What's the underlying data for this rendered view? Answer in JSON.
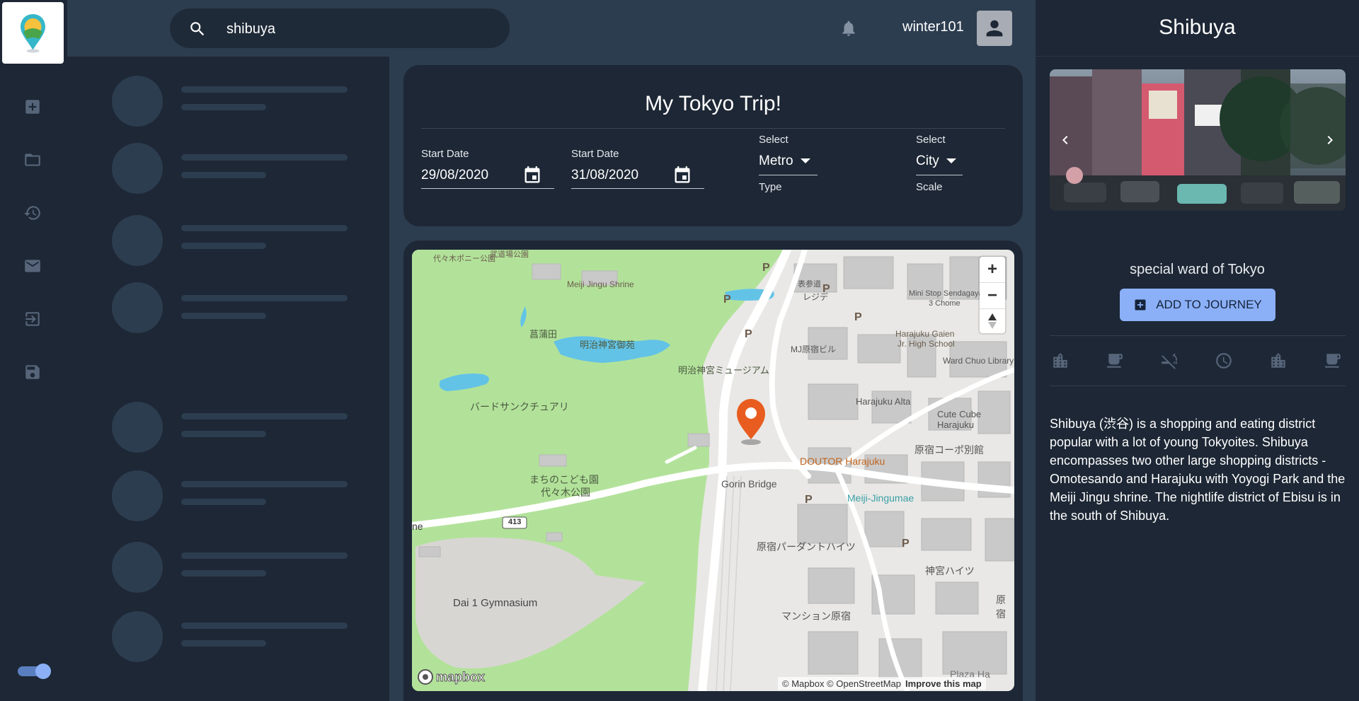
{
  "search": {
    "value": "shibuya",
    "placeholder": "Search"
  },
  "user": {
    "name": "winter101"
  },
  "nav": {
    "items": [
      {
        "icon": "add-box-icon"
      },
      {
        "icon": "folder-icon"
      },
      {
        "icon": "history-icon"
      },
      {
        "icon": "mail-icon"
      },
      {
        "icon": "logout-icon"
      },
      {
        "icon": "save-icon"
      }
    ]
  },
  "trip": {
    "title": "My Tokyo Trip!",
    "start_date": {
      "label": "Start Date",
      "value": "29/08/2020"
    },
    "end_date": {
      "label": "Start Date",
      "value": "31/08/2020"
    },
    "type_select": {
      "label": "Select",
      "value": "Metro",
      "helper": "Type"
    },
    "scale_select": {
      "label": "Select",
      "value": "City",
      "helper": "Scale"
    }
  },
  "map": {
    "labels": {
      "meiji_shrine": "Meiji Jingu Shrine",
      "bird_sanctuary": "バードサンクチュアリ",
      "shobuda": "菖蒲田",
      "meiji_jingu_gyoen": "明治神宮御苑",
      "museum": "明治神宮ミュージアム",
      "childrens_park": "まちのこども園",
      "yoyogi_park": "代々木公園",
      "gorin_bridge": "Gorin Bridge",
      "doutor": "DOUTOR Harajuku",
      "meiji_jingumae": "Meiji-Jingumae",
      "harajuku_alta": "Harajuku Alta",
      "cute_cube": "Cute Cube Harajuku",
      "harajuku_gaien": "Harajuku Gaien",
      "jr_high": "Jr. High School",
      "mini_stop": "Mini Stop Sendagaya",
      "third_chome": "3 Chome",
      "ward_library": "Ward Chuo Library",
      "parthenon_heights": "原宿パーダントハイツ",
      "jingu_heights": "神宮ハイツ",
      "mansion": "マンション原宿",
      "dai1_gym": "Dai 1 Gymnasium",
      "route": "413",
      "edge_label": "ne",
      "plaza": "Plaza Ha",
      "harajuku_corp": "原宿コーポ別館",
      "reji": "レジデ",
      "meiji_building": "MJ原宿ビル",
      "top_left": "代々木ポニー公園",
      "top_left2": "武道場公園",
      "top_right": "表参道",
      "edge_right": "原宿",
      "attribution": "© Mapbox © OpenStreetMap",
      "improve": "Improve this map",
      "mapbox_logo": "mapbox"
    },
    "controls": {
      "zoom_in": "+",
      "zoom_out": "−"
    }
  },
  "place": {
    "title": "Shibuya",
    "subtitle": "special ward of Tokyo",
    "add_button": "ADD TO JOURNEY",
    "description": "Shibuya (渋谷) is a shopping and eating district popular with a lot of young Tokyoites. Shibuya encompasses two other large shopping districts - Omotesando and Harajuku with Yoyogi Park and the Meiji Jingu shrine. The nightlife district of Ebisu is in the south of Shibuya.",
    "categories": [
      {
        "icon": "city-icon"
      },
      {
        "icon": "cafe-icon"
      },
      {
        "icon": "smoke-free-icon"
      },
      {
        "icon": "clock-icon"
      },
      {
        "icon": "city-icon"
      },
      {
        "icon": "cafe-icon"
      }
    ]
  },
  "colors": {
    "accent": "#8bb0f8",
    "panel": "#1d2735",
    "background": "#2d3d50",
    "pin": "#e85d1f"
  }
}
